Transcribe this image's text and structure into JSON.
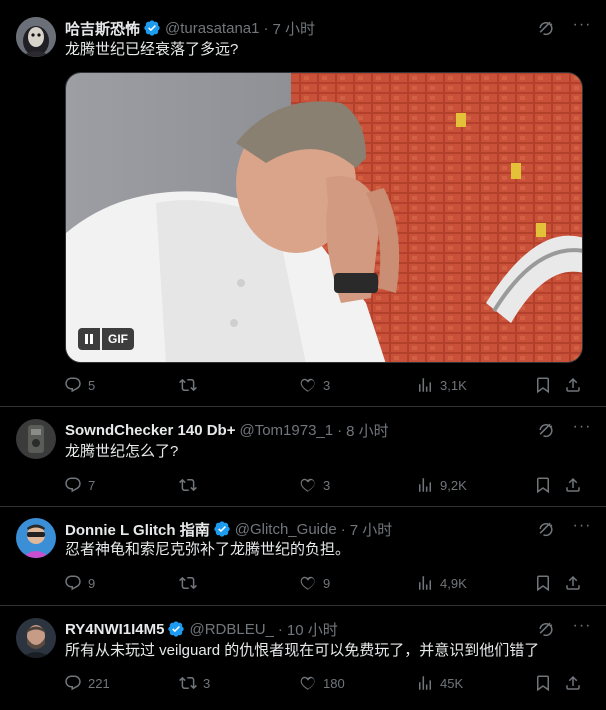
{
  "tweets": [
    {
      "name": "哈吉斯恐怖",
      "handle": "@turasatana1",
      "time": "7 小时",
      "text": "龙腾世纪已经衰落了多远?",
      "verified": true,
      "media": {
        "badge": "GIF"
      },
      "stats": {
        "replies": "5",
        "reposts": "",
        "likes": "3",
        "views": "3,1K"
      }
    },
    {
      "name": "SowndChecker 140 Db+",
      "handle": "@Tom1973_1",
      "time": "8 小时",
      "text": "龙腾世纪怎么了?",
      "verified": false,
      "stats": {
        "replies": "7",
        "reposts": "",
        "likes": "3",
        "views": "9,2K"
      }
    },
    {
      "name": "Donnie L Glitch 指南",
      "handle": "@Glitch_Guide",
      "time": "7 小时",
      "text": "忍者神龟和索尼克弥补了龙腾世纪的负担。",
      "verified": true,
      "stats": {
        "replies": "9",
        "reposts": "",
        "likes": "9",
        "views": "4,9K"
      }
    },
    {
      "name": "RY4NWI1I4M5",
      "handle": "@RDBLEU_",
      "time": "10 小时",
      "text": "所有从未玩过 veilguard 的仇恨者现在可以免费玩了，并意识到他们错了",
      "verified": true,
      "stats": {
        "replies": "221",
        "reposts": "3",
        "likes": "180",
        "views": "45K"
      }
    }
  ],
  "ui": {
    "separator": "·",
    "more": "···",
    "accent": "#1d9bf0",
    "muted": "#71767b",
    "icons": [
      "grok-icon",
      "reply-icon",
      "repost-icon",
      "like-icon",
      "views-icon",
      "bookmark-icon",
      "share-icon",
      "verified-icon",
      "pause-icon"
    ]
  }
}
